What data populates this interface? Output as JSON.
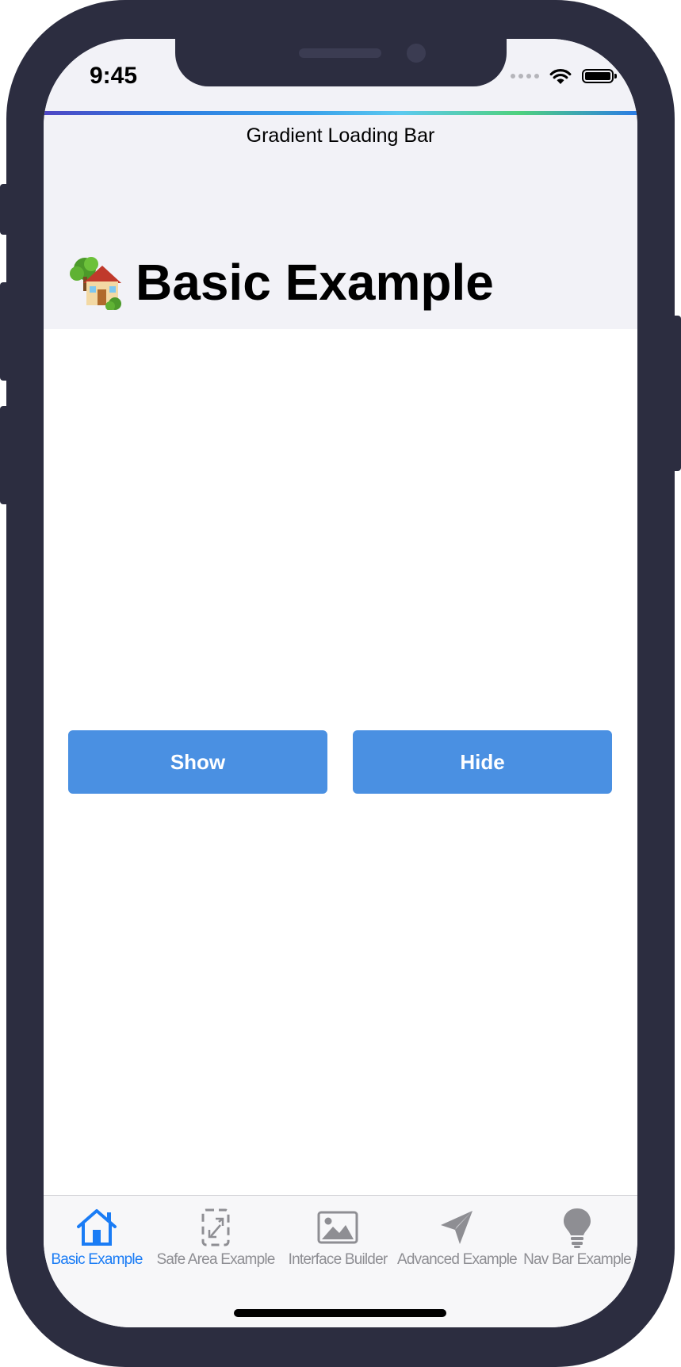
{
  "status_bar": {
    "time": "9:45"
  },
  "nav": {
    "title": "Gradient Loading Bar",
    "large_title": "Basic Example",
    "title_emoji": "house-with-garden-icon"
  },
  "buttons": {
    "show_label": "Show",
    "hide_label": "Hide",
    "color": "#4a90e2"
  },
  "tabs": [
    {
      "label": "Basic Example",
      "icon": "house-icon",
      "active": true
    },
    {
      "label": "Safe Area Example",
      "icon": "resize-arrows-icon",
      "active": false
    },
    {
      "label": "Interface Builder",
      "icon": "photo-icon",
      "active": false
    },
    {
      "label": "Advanced Example",
      "icon": "paper-plane-icon",
      "active": false
    },
    {
      "label": "Nav Bar Example",
      "icon": "lightbulb-icon",
      "active": false
    }
  ],
  "colors": {
    "accent": "#1a7cf5",
    "inactive_tab": "#8e8e93",
    "device_frame": "#2c2d40",
    "header_background": "#f2f2f7"
  }
}
